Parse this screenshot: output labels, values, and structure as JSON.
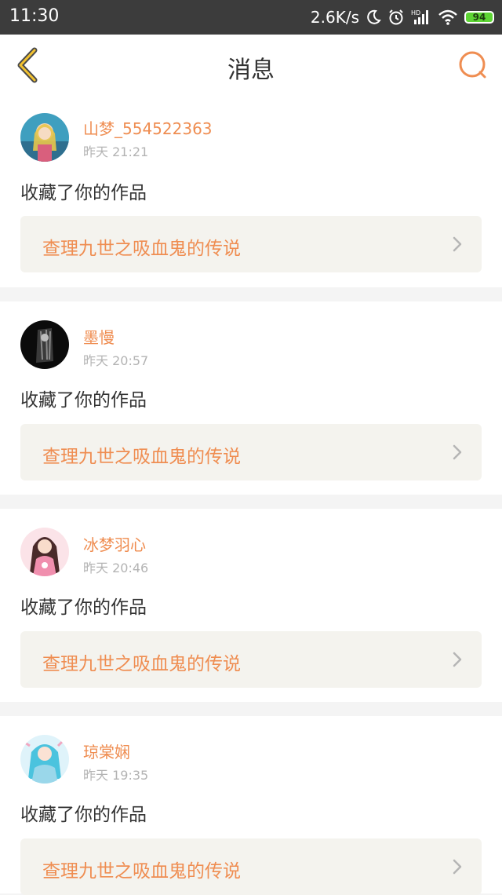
{
  "status_bar": {
    "time": "11:30",
    "net_speed": "2.6K/s",
    "battery": "94",
    "icons": [
      "moon-icon",
      "alarm-icon",
      "hd-signal-icon",
      "wifi-icon",
      "battery-icon"
    ]
  },
  "header": {
    "title": "消息",
    "back_icon": "chevron-left-icon",
    "search_icon": "search-icon",
    "accent": "#ef8d51"
  },
  "messages": [
    {
      "username": "山梦_554522363",
      "time": "昨天 21:21",
      "action": "收藏了你的作品",
      "work": "查理九世之吸血鬼的传说"
    },
    {
      "username": "墨慢",
      "time": "昨天 20:57",
      "action": "收藏了你的作品",
      "work": "查理九世之吸血鬼的传说"
    },
    {
      "username": "冰梦羽心",
      "time": "昨天 20:46",
      "action": "收藏了你的作品",
      "work": "查理九世之吸血鬼的传说"
    },
    {
      "username": "琼棠娴",
      "time": "昨天 19:35",
      "action": "收藏了你的作品",
      "work": "查理九世之吸血鬼的传说"
    }
  ]
}
